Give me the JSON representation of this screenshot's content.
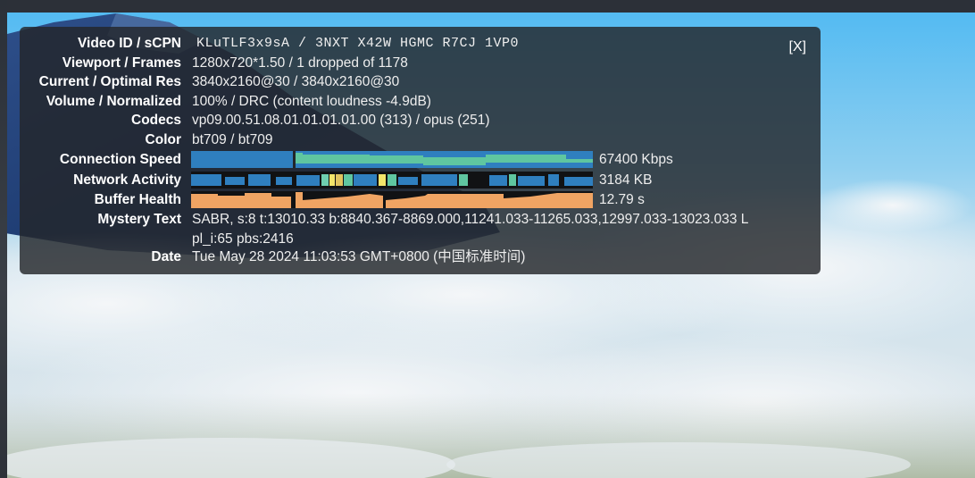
{
  "stats": {
    "close_label": "[X]",
    "video_id": {
      "label": "Video ID / sCPN",
      "value": "KLuTLF3x9sA / 3NXT X42W HGMC R7CJ 1VP0"
    },
    "viewport": {
      "label": "Viewport / Frames",
      "value": "1280x720*1.50 / 1 dropped of 1178"
    },
    "resolution": {
      "label": "Current / Optimal Res",
      "value": "3840x2160@30 / 3840x2160@30"
    },
    "volume": {
      "label": "Volume / Normalized",
      "value": "100% / DRC (content loudness -4.9dB)"
    },
    "codecs": {
      "label": "Codecs",
      "value": "vp09.00.51.08.01.01.01.01.00 (313) / opus (251)"
    },
    "color": {
      "label": "Color",
      "value": "bt709 / bt709"
    },
    "connection_speed": {
      "label": "Connection Speed",
      "value": "67400 Kbps"
    },
    "network_activity": {
      "label": "Network Activity",
      "value": "3184 KB"
    },
    "buffer_health": {
      "label": "Buffer Health",
      "value": "12.79 s"
    },
    "mystery_text": {
      "label": "Mystery Text",
      "line1": "SABR, s:8 t:13010.33 b:8840.367-8869.000,11241.033-11265.033,12997.033-13023.033 L",
      "line2": "pl_i:65 pbs:2416"
    },
    "date": {
      "label": "Date",
      "value": "Tue May 28 2024 11:03:53 GMT+0800 (中国标准时间)"
    }
  },
  "colors": {
    "connection_blue": "#2f7fbf",
    "connection_teal": "#5fc6a0",
    "network_blue": "#2f7fbf",
    "buffer_orange": "#f0a463"
  }
}
